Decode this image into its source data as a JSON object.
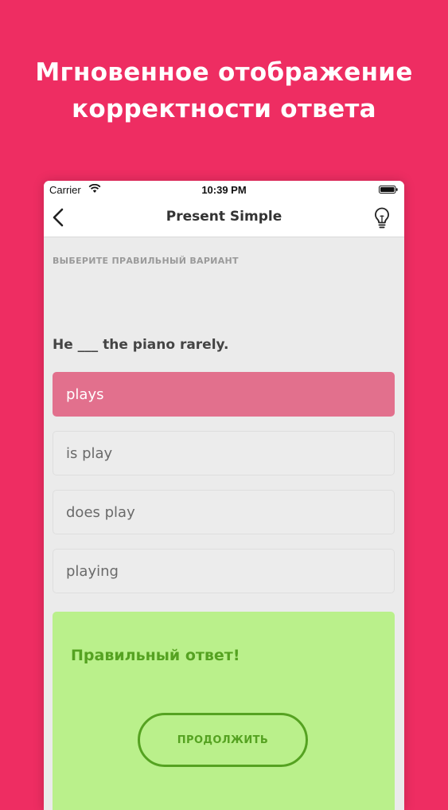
{
  "headline": {
    "line1": "Мгновенное отображение",
    "line2": "корректности ответа"
  },
  "status_bar": {
    "carrier": "Carrier",
    "time": "10:39 PM",
    "icons": [
      "wifi-icon",
      "battery-icon"
    ]
  },
  "nav": {
    "title": "Present Simple",
    "icons": [
      "back-chevron-icon",
      "lightbulb-icon"
    ]
  },
  "quiz": {
    "instruction": "ВЫБЕРИТЕ ПРАВИЛЬНЫЙ ВАРИАНТ",
    "question": "He ___ the piano rarely.",
    "options": [
      {
        "label": "plays",
        "state": "correct"
      },
      {
        "label": "is play",
        "state": "default"
      },
      {
        "label": "does play",
        "state": "default"
      },
      {
        "label": "playing",
        "state": "default"
      }
    ]
  },
  "feedback": {
    "message": "Правильный ответ!",
    "continue_label": "ПРОДОЛЖИТЬ"
  },
  "colors": {
    "background": "#ee2d62",
    "correct_option": "#e2708d",
    "feedback_panel": "#baf08b",
    "feedback_accent": "#55a221"
  }
}
